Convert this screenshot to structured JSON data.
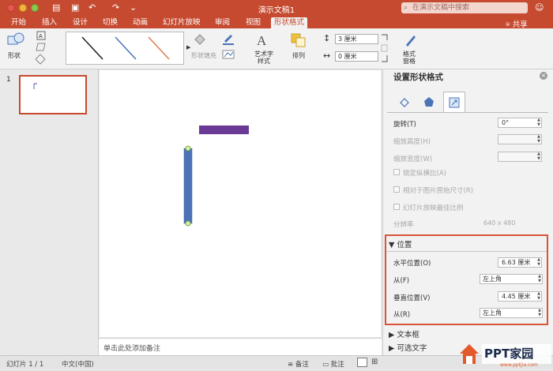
{
  "window": {
    "title": "演示文稿1",
    "search_placeholder": "在演示文稿中搜索"
  },
  "tabs": [
    "开始",
    "插入",
    "设计",
    "切换",
    "动画",
    "幻灯片放映",
    "审阅",
    "视图",
    "形状格式"
  ],
  "active_tab": "形状格式",
  "share_label": "共享",
  "ribbon": {
    "shapes_label": "形状",
    "shape_fill_label": "形状填充",
    "wordart_label": "艺术字\n样式",
    "arrange_label": "排列",
    "height_value": "3 厘米",
    "width_value": "0 厘米",
    "format_pane_label": "格式\n窗格"
  },
  "thumbnails": [
    {
      "number": "1"
    }
  ],
  "notes_placeholder": "单击此处添加备注",
  "format_pane": {
    "title": "设置形状格式",
    "rotation_label": "旋转(T)",
    "rotation_value": "0°",
    "scale_height_label": "缩放高度(H)",
    "scale_width_label": "缩放宽度(W)",
    "lock_aspect_label": "锁定纵横比(A)",
    "relative_original_label": "相对于图片原始尺寸(R)",
    "best_scale_label": "幻灯片放映最佳比例",
    "resolution_label": "分辨率",
    "resolution_value": "640 x 480",
    "position_section": "位置",
    "horizontal_label": "水平位置(O)",
    "horizontal_value": "6.63 厘米",
    "from_f_label": "从(F)",
    "from_f_value": "左上角",
    "vertical_label": "垂直位置(V)",
    "vertical_value": "4.45 厘米",
    "from_r_label": "从(R)",
    "from_r_value": "左上角",
    "textbox_section": "文本框",
    "alt_text_section": "可选文字"
  },
  "status_bar": {
    "slide_info": "幻灯片 1 / 1",
    "language": "中文(中国)",
    "notes_label": "备注",
    "comments_label": "批注"
  },
  "watermark": {
    "brand": "PPT家园",
    "url": "www.pptjia.com"
  },
  "colors": {
    "accent": "#c64a2f",
    "highlight_box": "#d9533b",
    "shape_purple": "#6b3a96",
    "shape_blue": "#4a73b8"
  }
}
